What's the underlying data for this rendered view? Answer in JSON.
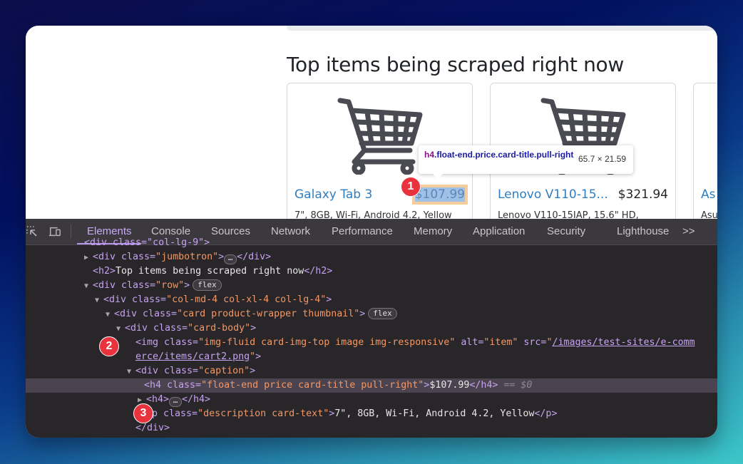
{
  "page": {
    "heading": "Top items being scraped right now",
    "products": [
      {
        "title": "Galaxy Tab 3",
        "price": "$107.99",
        "description": "7\", 8GB, Wi-Fi, Android 4.2, Yellow",
        "image": "shopping-cart-icon"
      },
      {
        "title": "Lenovo V110-15...",
        "price": "$321.94",
        "description": "Lenovo V110-15IAP, 15.6\" HD,",
        "image": "shopping-cart-icon"
      },
      {
        "title": "As",
        "price": "",
        "description": "Asu",
        "image": "shopping-cart-icon"
      }
    ]
  },
  "tooltip": {
    "tag": "h4",
    "classes": ".float-end.price.card-title.pull-right",
    "dimensions": "65.7 × 21.59"
  },
  "badges": [
    "1",
    "2",
    "3"
  ],
  "devtools": {
    "tabs": [
      "Elements",
      "Console",
      "Sources",
      "Network",
      "Performance",
      "Memory",
      "Application",
      "Security",
      "Lighthouse"
    ],
    "active_tab": "Elements",
    "more_tabs": ">>",
    "icons": [
      "inspect-element-icon",
      "device-toggle-icon"
    ],
    "dom": {
      "l0": "<div class=\"col-lg-9\">",
      "jumbotron_open": "<div ",
      "jumbotron_attr": "class",
      "jumbotron_val": "\"jumbotron\"",
      "h2_text": "Top items being scraped right now",
      "row_val": "\"row\"",
      "col_val": "\"col-md-4 col-xl-4 col-lg-4\"",
      "card_val": "\"card product-wrapper thumbnail\"",
      "cardbody_val": "\"card-body\"",
      "img_class_val": "\"img-fluid card-img-top image img-responsive\"",
      "img_alt_val": "\"item\"",
      "img_src_1": "/images/test-sites/e-comm",
      "img_src_2": "erce/items/cart2.png",
      "caption_val": "\"caption\"",
      "h4_class_val": "\"float-end price card-title pull-right\"",
      "h4_text": "$107.99",
      "selected_marker": "== $0",
      "p_class_val": "\"description card-text\"",
      "p_text": "7\", 8GB, Wi-Fi, Android 4.2, Yellow",
      "flex_badge": "flex",
      "ellipsis": "…"
    }
  }
}
